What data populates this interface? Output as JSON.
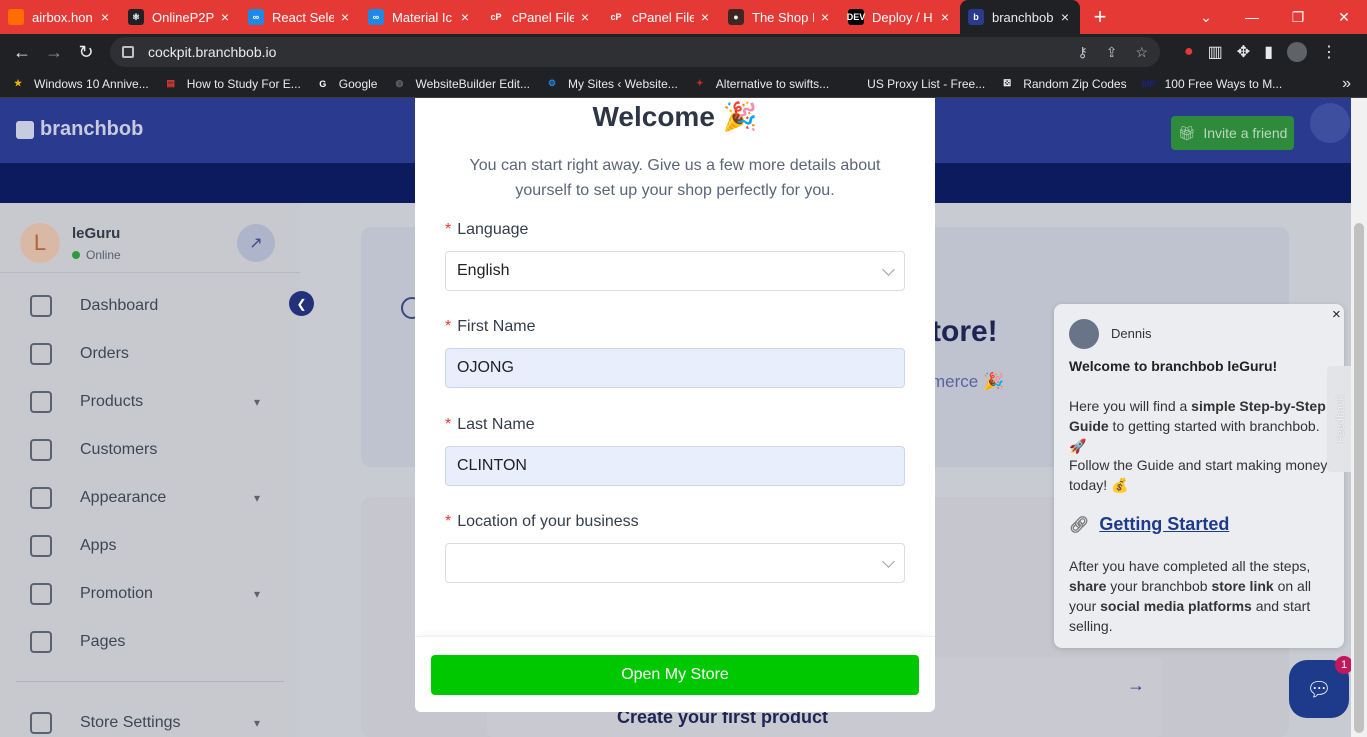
{
  "browser": {
    "tabs": [
      {
        "title": "airbox.hon",
        "favicon": "airbox-icon",
        "color": "#ff6d00",
        "glyph": ""
      },
      {
        "title": "OnlineP2P",
        "favicon": "react-icon",
        "color": "#202124",
        "glyph": "⚛"
      },
      {
        "title": "React Selec",
        "favicon": "react-select-icon",
        "color": "#1e88e5",
        "glyph": "∞"
      },
      {
        "title": "Material Ic",
        "favicon": "material-icon",
        "color": "#1e88e5",
        "glyph": "∞"
      },
      {
        "title": "cPanel File",
        "favicon": "cpanel-icon",
        "color": "#e53935",
        "glyph": "cP"
      },
      {
        "title": "cPanel File",
        "favicon": "cpanel-icon",
        "color": "#e53935",
        "glyph": "cP"
      },
      {
        "title": "The Shop I",
        "favicon": "shop-icon",
        "color": "#3e2723",
        "glyph": "●"
      },
      {
        "title": "Deploy / H",
        "favicon": "dev-icon",
        "color": "#000000",
        "glyph": "DEV"
      },
      {
        "title": "branchbob",
        "favicon": "branchbob-icon",
        "color": "#2a3a8e",
        "glyph": "b"
      }
    ],
    "tab_close": "×",
    "new_tab": "+",
    "window_controls": {
      "minimize": "—",
      "restore": "❐",
      "close": "✕",
      "tabsearch": "⌄"
    },
    "url": "cockpit.branchbob.io",
    "bookmarks": [
      {
        "label": "Windows 10 Annive...",
        "icon": "star-icon",
        "color": "#f4b400",
        "glyph": "★"
      },
      {
        "label": "How to Study For E...",
        "icon": "bookmark-icon",
        "color": "#e53935",
        "glyph": "▤"
      },
      {
        "label": "Google",
        "icon": "google-icon",
        "color": "#ffffff",
        "glyph": "G"
      },
      {
        "label": "WebsiteBuilder Edit...",
        "icon": "globe-icon",
        "color": "#5f6368",
        "glyph": "◍"
      },
      {
        "label": "My Sites ‹ Website...",
        "icon": "gear-icon",
        "color": "#1e88e5",
        "glyph": "⚙"
      },
      {
        "label": "Alternative to swifts...",
        "icon": "swift-icon",
        "color": "#c62828",
        "glyph": "✦"
      },
      {
        "label": "US Proxy List - Free...",
        "icon": "proxy-icon",
        "color": "#202124",
        "glyph": ""
      },
      {
        "label": "Random Zip Codes",
        "icon": "dice-icon",
        "color": "#ffffff",
        "glyph": "⚄"
      },
      {
        "label": "100 Free Ways to M...",
        "icon": "mp-icon",
        "color": "#1a237e",
        "glyph": "MP"
      }
    ],
    "bookmarks_more": "»"
  },
  "app": {
    "logo": "branchbob",
    "invite_label": "Invite a friend",
    "user": {
      "initial": "L",
      "name": "leGuru",
      "status": "Online"
    },
    "nav": [
      {
        "label": "Dashboard",
        "icon": "dashboard-icon",
        "has_children": false
      },
      {
        "label": "Orders",
        "icon": "cart-icon",
        "has_children": false
      },
      {
        "label": "Products",
        "icon": "box-icon",
        "has_children": true
      },
      {
        "label": "Customers",
        "icon": "users-icon",
        "has_children": false
      },
      {
        "label": "Appearance",
        "icon": "palette-icon",
        "has_children": true
      },
      {
        "label": "Apps",
        "icon": "rocket-icon",
        "has_children": false
      },
      {
        "label": "Promotion",
        "icon": "discount-icon",
        "has_children": true
      },
      {
        "label": "Pages",
        "icon": "list-icon",
        "has_children": false
      },
      {
        "label": "Store Settings",
        "icon": "settings-icon",
        "has_children": true
      }
    ],
    "background": {
      "heading": "tore!",
      "subtext": "merce 🎉",
      "task_text": "Create your first product"
    }
  },
  "modal": {
    "title": "Welcome 🎉",
    "intro": "You can start right away. Give us a few more details about yourself to set up your shop perfectly for you.",
    "required_mark": "*",
    "fields": {
      "language": {
        "label": "Language",
        "value": "English"
      },
      "first_name": {
        "label": "First Name",
        "value": "OJONG"
      },
      "last_name": {
        "label": "Last Name",
        "value": "CLINTON"
      },
      "location": {
        "label": "Location of your business",
        "value": ""
      }
    },
    "submit_label": "Open My Store"
  },
  "chat": {
    "agent": "Dennis",
    "close": "×",
    "title": "Welcome to branchbob leGuru!",
    "p1_pre": "Here you will find a ",
    "p1_bold": "simple Step-by-Step Guide",
    "p1_post": " to getting started with branchbob. 🚀",
    "p2": "Follow the Guide and start making money today! 💰",
    "link": "Getting Started",
    "p3_a": "After you have completed all the steps, ",
    "p3_b": "share",
    "p3_c": " your branchbob ",
    "p3_d": "store link",
    "p3_e": " on all your ",
    "p3_f": "social media platforms",
    "p3_g": " and start selling.",
    "feedback": "Feedback",
    "badge": "1"
  }
}
